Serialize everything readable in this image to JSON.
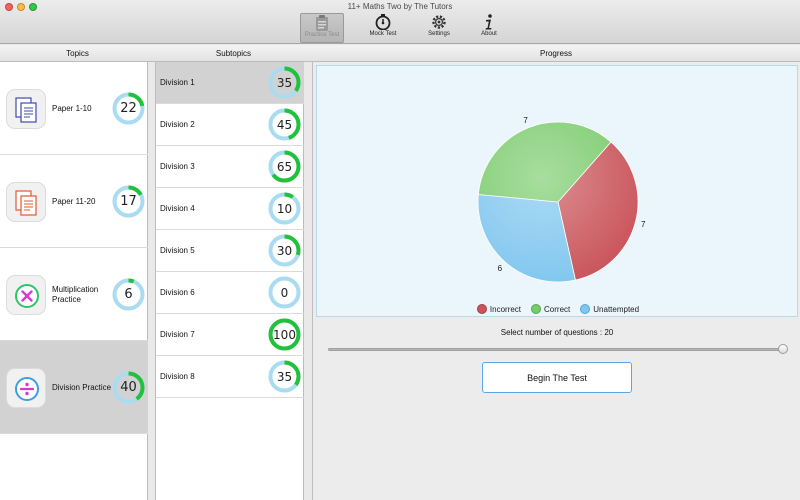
{
  "window": {
    "title": "11+ Maths Two by The Tutors"
  },
  "toolbar": {
    "items": [
      {
        "label": "Practice Test",
        "icon": "clipboard-icon",
        "active": true
      },
      {
        "label": "Mock Test",
        "icon": "stopwatch-icon",
        "active": false
      },
      {
        "label": "Settings",
        "icon": "gear-icon",
        "active": false
      },
      {
        "label": "About",
        "icon": "info-icon",
        "active": false
      }
    ]
  },
  "columns": {
    "topics": "Topics",
    "subtopics": "Subtopics",
    "progress": "Progress"
  },
  "topics": [
    {
      "label": "Paper 1-10",
      "value": "22",
      "progress": 0.22,
      "icon": "document-icon",
      "selected": false
    },
    {
      "label": "Paper 11-20",
      "value": "17",
      "progress": 0.17,
      "icon": "document-orange-icon",
      "selected": false
    },
    {
      "label": "Multiplication Practice",
      "value": "6",
      "progress": 0.06,
      "icon": "multiply-icon",
      "selected": false
    },
    {
      "label": "Division Practice",
      "value": "40",
      "progress": 0.4,
      "icon": "divide-icon",
      "selected": true
    }
  ],
  "subtopics": [
    {
      "label": "Division 1",
      "value": "35",
      "progress": 0.35,
      "selected": true
    },
    {
      "label": "Division 2",
      "value": "45",
      "progress": 0.45,
      "selected": false
    },
    {
      "label": "Division 3",
      "value": "65",
      "progress": 0.65,
      "selected": false
    },
    {
      "label": "Division 4",
      "value": "10",
      "progress": 0.1,
      "selected": false
    },
    {
      "label": "Division 5",
      "value": "30",
      "progress": 0.3,
      "selected": false
    },
    {
      "label": "Division 6",
      "value": "0",
      "progress": 0.0,
      "selected": false
    },
    {
      "label": "Division 7",
      "value": "100",
      "progress": 1.0,
      "selected": false
    },
    {
      "label": "Division 8",
      "value": "35",
      "progress": 0.35,
      "selected": false
    }
  ],
  "progress": {
    "select_label": "Select number of questions : 20",
    "slider_value": 20,
    "slider_fraction": 1.0,
    "begin_button": "Begin The Test"
  },
  "colors": {
    "ring_fill": "#1fc23a",
    "ring_track": "#a9dcf0",
    "incorrect": "#c9545a",
    "correct": "#7acb6c",
    "unattempted": "#80c6ef"
  },
  "chart_data": {
    "type": "pie",
    "slices": [
      {
        "name": "Incorrect",
        "value": 7,
        "label": "7",
        "color": "#c9545a"
      },
      {
        "name": "Unattempted",
        "value": 6,
        "label": "6",
        "color": "#80c6ef"
      },
      {
        "name": "Correct",
        "value": 7,
        "label": "7",
        "color": "#7acb6c"
      }
    ],
    "legend": [
      "Incorrect",
      "Correct",
      "Unattempted"
    ],
    "legend_position": "bottom"
  }
}
